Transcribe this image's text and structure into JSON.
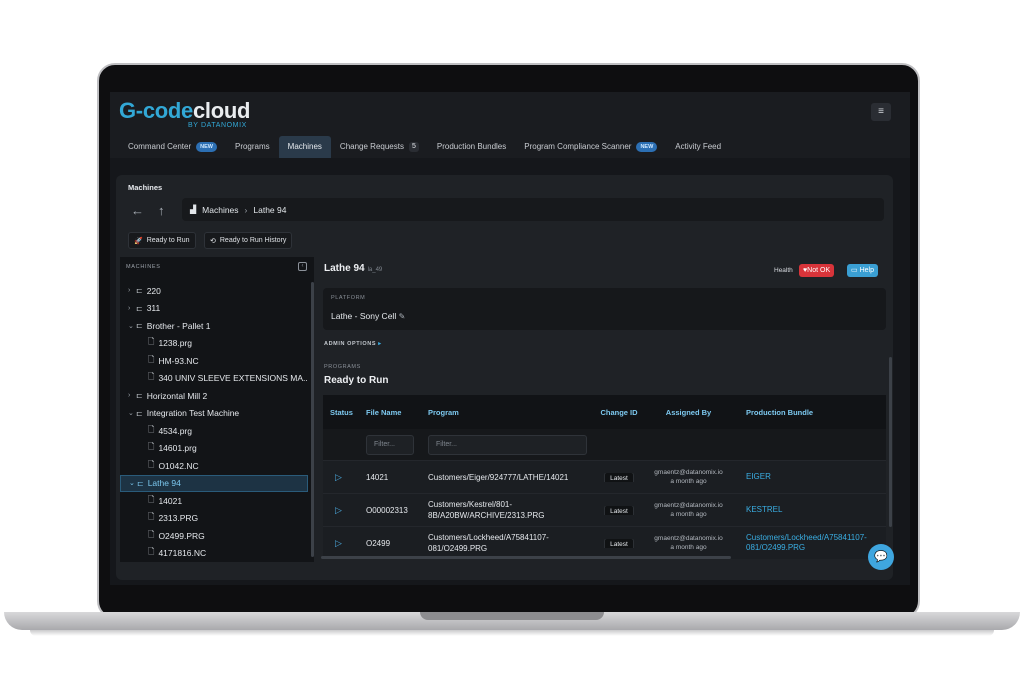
{
  "app": {
    "logo_main": "G-code",
    "logo_cloud": "cloud",
    "logo_sub": "BY DATANOMIX",
    "menu_icon": "hamburger-icon",
    "accent": "#32a8d6"
  },
  "tabs": [
    {
      "label": "Command Center",
      "badge": "NEW"
    },
    {
      "label": "Programs"
    },
    {
      "label": "Machines",
      "active": true
    },
    {
      "label": "Change Requests",
      "count": "5"
    },
    {
      "label": "Production Bundles"
    },
    {
      "label": "Program Compliance Scanner",
      "badge": "NEW"
    },
    {
      "label": "Activity Feed"
    }
  ],
  "panel": {
    "title": "Machines",
    "breadcrumb": {
      "root": "Machines",
      "current": "Lathe 94"
    },
    "buttons": {
      "ready_to_run": "Ready to Run",
      "history": "Ready to Run History"
    }
  },
  "sidebar": {
    "header": "MACHINES",
    "tree": [
      {
        "label": "220",
        "type": "machine",
        "chev": "›"
      },
      {
        "label": "311",
        "type": "machine",
        "chev": "›"
      },
      {
        "label": "Brother - Pallet 1",
        "type": "machine",
        "chev": "⌄"
      },
      {
        "label": "1238.prg",
        "type": "file"
      },
      {
        "label": "HM-93.NC",
        "type": "file"
      },
      {
        "label": "340 UNIV SLEEVE EXTENSIONS MA...",
        "type": "file"
      },
      {
        "label": "Horizontal Mill 2",
        "type": "machine",
        "chev": "›"
      },
      {
        "label": "Integration Test Machine",
        "type": "machine",
        "chev": "⌄"
      },
      {
        "label": "4534.prg",
        "type": "file"
      },
      {
        "label": "14601.prg",
        "type": "file"
      },
      {
        "label": "O1042.NC",
        "type": "file"
      },
      {
        "label": "Lathe 94",
        "type": "machine",
        "chev": "⌄",
        "selected": true
      },
      {
        "label": "14021",
        "type": "file"
      },
      {
        "label": "2313.PRG",
        "type": "file"
      },
      {
        "label": "O2499.PRG",
        "type": "file"
      },
      {
        "label": "4171816.NC",
        "type": "file"
      }
    ]
  },
  "detail": {
    "title": "Lathe 94",
    "subtitle": "la_49",
    "health_label": "Health",
    "health_status": "♥Not OK",
    "help": "Help",
    "platform_label": "PLATFORM",
    "platform_value": "Lathe - Sony Cell",
    "admin_options": "ADMIN OPTIONS",
    "programs_label": "PROGRAMS",
    "section_title": "Ready to Run",
    "table": {
      "headers": [
        "Status",
        "File Name",
        "Program",
        "Change ID",
        "Assigned By",
        "Production Bundle"
      ],
      "filter_placeholder": "Filter...",
      "rows": [
        {
          "file": "14021",
          "program": "Customers/Eiger/924777/LATHE/14021",
          "change": "Latest",
          "assigned": "gmaentz@datanomix.io",
          "when": "a month ago",
          "bundle": "EIGER"
        },
        {
          "file": "O00002313",
          "program": "Customers/Kestrel/801-8B/A20BW/ARCHIVE/2313.PRG",
          "change": "Latest",
          "assigned": "gmaentz@datanomix.io",
          "when": "a month ago",
          "bundle": "KESTREL"
        },
        {
          "file": "O2499",
          "program": "Customers/Lockheed/A75841107-081/O2499.PRG",
          "change": "Latest",
          "assigned": "gmaentz@datanomix.io",
          "when": "a month ago",
          "bundle": "Customers/Lockheed/A75841107-081/O2499.PRG"
        }
      ]
    }
  }
}
